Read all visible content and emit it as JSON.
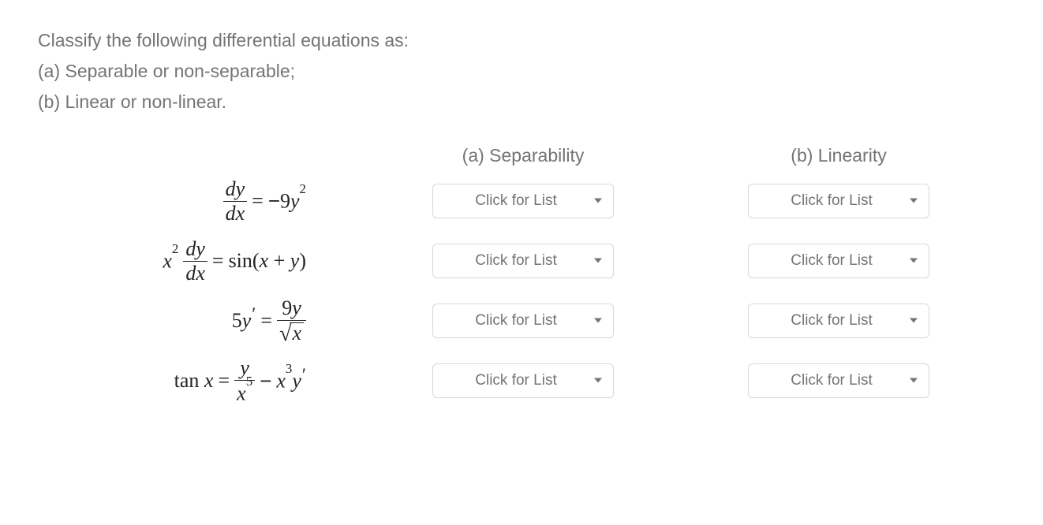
{
  "instructions": {
    "line1": "Classify the following differential equations as:",
    "line2": "(a) Separable or non-separable;",
    "line3": "(b) Linear or non-linear."
  },
  "headers": {
    "separability": "(a) Separability",
    "linearity": "(b) Linearity"
  },
  "dropdown_placeholder": "Click for List",
  "equations": {
    "eq1": "dy/dx = -9y^2",
    "eq2": "x^2 dy/dx = sin(x + y)",
    "eq3": "5y' = 9y / sqrt(x)",
    "eq4": "tan x = y / x^5 - x^3 y'"
  }
}
